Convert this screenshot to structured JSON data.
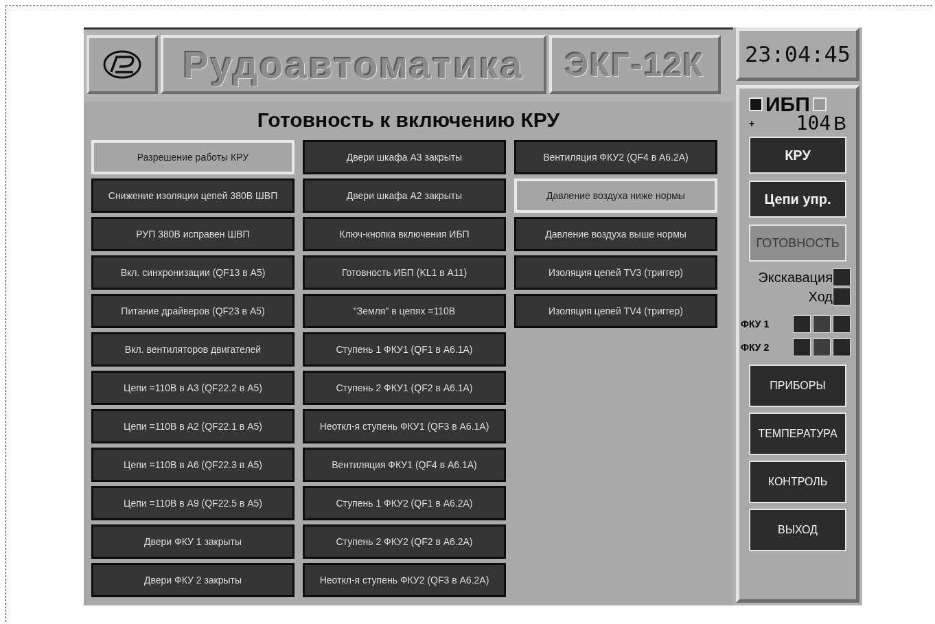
{
  "header": {
    "company": "Рудоавтоматика",
    "model": "ЭКГ-12К"
  },
  "title": "Готовность к включению КРУ",
  "columns": [
    [
      {
        "label": "Разрешение работы КРУ",
        "active": true
      },
      {
        "label": "Снижение изоляции цепей 380В ШВП",
        "active": false
      },
      {
        "label": "РУП 380В исправен ШВП",
        "active": false
      },
      {
        "label": "Вкл. синхронизации (QF13 в А5)",
        "active": false
      },
      {
        "label": "Питание драйверов (QF23 в А5)",
        "active": false
      },
      {
        "label": "Вкл. вентиляторов двигателей",
        "active": false
      },
      {
        "label": "Цепи =110В в А3 (QF22.2 в А5)",
        "active": false
      },
      {
        "label": "Цепи =110В в А2 (QF22.1 в А5)",
        "active": false
      },
      {
        "label": "Цепи =110В в А6 (QF22.3 в А5)",
        "active": false
      },
      {
        "label": "Цепи =110В в А9 (QF22.5 в А5)",
        "active": false
      },
      {
        "label": "Двери ФКУ 1 закрыты",
        "active": false
      },
      {
        "label": "Двери ФКУ 2 закрыты",
        "active": false
      }
    ],
    [
      {
        "label": "Двери шкафа А3 закрыты",
        "active": false
      },
      {
        "label": "Двери шкафа А2 закрыты",
        "active": false
      },
      {
        "label": "Ключ-кнопка включения ИБП",
        "active": false
      },
      {
        "label": "Готовность ИБП (KL1 в А11)",
        "active": false
      },
      {
        "label": "\"Земля\" в цепях =110В",
        "active": false
      },
      {
        "label": "Ступень 1 ФКУ1 (QF1 в А6.1А)",
        "active": false
      },
      {
        "label": "Ступень 2 ФКУ1 (QF2 в А6.1А)",
        "active": false
      },
      {
        "label": "Неоткл-я ступень ФКУ1 (QF3 в А6.1А)",
        "active": false
      },
      {
        "label": "Вентиляция ФКУ1 (QF4 в А6.1А)",
        "active": false
      },
      {
        "label": "Ступень 1 ФКУ2 (QF1 в А6.2А)",
        "active": false
      },
      {
        "label": "Ступень 2 ФКУ2 (QF2 в А6.2А)",
        "active": false
      },
      {
        "label": "Неоткл-я ступень ФКУ2 (QF3 в А6.2А)",
        "active": false
      }
    ],
    [
      {
        "label": "Вентиляция ФКУ2 (QF4 в А6.2А)",
        "active": false
      },
      {
        "label": "Давление воздуха ниже нормы",
        "active": true
      },
      {
        "label": "Давление воздуха выше нормы",
        "active": false
      },
      {
        "label": "Изоляция цепей TV3 (триггер)",
        "active": false
      },
      {
        "label": "Изоляция цепей TV4 (триггер)",
        "active": false
      }
    ]
  ],
  "sidebar": {
    "clock": "23:04:45",
    "ups": {
      "label": "ИБП",
      "lamps": [
        {
          "color": "#141414"
        },
        {
          "color": "#9a9a9a"
        }
      ],
      "sign": "+",
      "voltage": "104",
      "unit": "В"
    },
    "top_buttons": [
      {
        "label": "КРУ",
        "active": false,
        "bold": true
      },
      {
        "label": "Цепи упр.",
        "active": false,
        "bold": true
      },
      {
        "label": "ГОТОВНОСТЬ",
        "active": true,
        "bold": false
      }
    ],
    "modes": [
      {
        "label": "Экскавация",
        "color": "#262626"
      },
      {
        "label": "Ход",
        "color": "#262626"
      }
    ],
    "fku": [
      {
        "label": "ФКУ 1",
        "lamps": [
          {
            "color": "#262626"
          },
          {
            "color": "#3e3e3e"
          },
          {
            "color": "#262626"
          }
        ]
      },
      {
        "label": "ФКУ 2",
        "lamps": [
          {
            "color": "#262626"
          },
          {
            "color": "#3e3e3e"
          },
          {
            "color": "#262626"
          }
        ]
      }
    ],
    "bottom_buttons": [
      {
        "label": "ПРИБОРЫ",
        "active": false,
        "bold": false
      },
      {
        "label": "ТЕМПЕРАТУРА",
        "active": false,
        "bold": false
      },
      {
        "label": "КОНТРОЛЬ",
        "active": false,
        "bold": false
      },
      {
        "label": "ВЫХОД",
        "active": false,
        "bold": false
      }
    ]
  }
}
